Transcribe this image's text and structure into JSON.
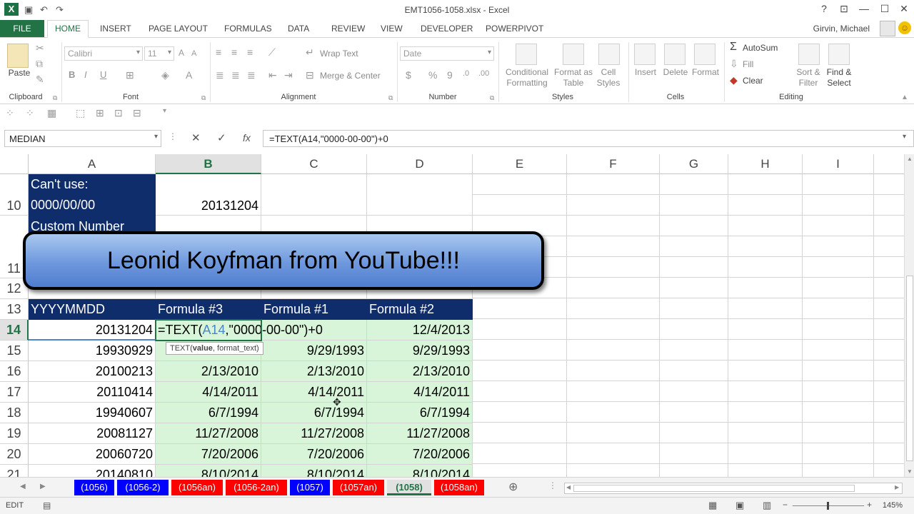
{
  "window": {
    "title": "EMT1056-1058.xlsx - Excel",
    "help": "?",
    "ribbon_display": "⊡",
    "minimize": "—",
    "maximize": "☐",
    "close": "✕"
  },
  "tabs": {
    "file": "FILE",
    "items": [
      "HOME",
      "INSERT",
      "PAGE LAYOUT",
      "FORMULAS",
      "DATA",
      "REVIEW",
      "VIEW",
      "DEVELOPER",
      "POWERPIVOT"
    ],
    "active": "HOME",
    "user": "Girvin, Michael"
  },
  "ribbon": {
    "clipboard": {
      "label": "Clipboard",
      "paste": "Paste"
    },
    "font": {
      "label": "Font",
      "name": "Calibri",
      "size": "11",
      "bold": "B",
      "italic": "I",
      "underline": "U"
    },
    "alignment": {
      "label": "Alignment",
      "wrap_text": "Wrap Text",
      "merge_center": "Merge & Center"
    },
    "number": {
      "label": "Number",
      "format": "Date",
      "currency": "$",
      "percent": "%",
      "comma": "9"
    },
    "styles": {
      "label": "Styles",
      "conditional": "Conditional",
      "formatting": "Formatting",
      "format_as": "Format as",
      "table": "Table",
      "cell": "Cell",
      "cell_styles": "Styles"
    },
    "cells": {
      "label": "Cells",
      "insert": "Insert",
      "delete": "Delete",
      "format": "Format"
    },
    "editing": {
      "label": "Editing",
      "autosum": "AutoSum",
      "fill": "Fill",
      "clear": "Clear",
      "sort": "Sort &",
      "filter": "Filter",
      "find": "Find &",
      "select": "Select"
    }
  },
  "formula_bar": {
    "name_box": "MEDIAN",
    "cancel": "✕",
    "enter": "✓",
    "fx": "fx",
    "formula": "=TEXT(A14,\"0000-00-00\")+0"
  },
  "grid": {
    "columns": [
      "A",
      "B",
      "C",
      "D",
      "E",
      "F",
      "G",
      "H",
      "I"
    ],
    "rows": {
      "r10": {
        "num": "10",
        "a1": "Can't use:",
        "a2": "0000/00/00",
        "b": "20131204"
      },
      "r11": {
        "num": "11",
        "a": "Custom Number"
      },
      "r12": {
        "num": "12"
      },
      "r13": {
        "num": "13",
        "a": "YYYYMMDD",
        "b": "Formula #3",
        "c": "Formula #1",
        "d": "Formula #2"
      },
      "r14": {
        "num": "14",
        "a": "20131204",
        "b_pre": "=TEXT(",
        "b_ref": "A14",
        "b_post": ",\"0000-00-00\")+0",
        "d": "12/4/2013"
      },
      "r15": {
        "num": "15",
        "a": "19930929",
        "b": "9/29/1993",
        "c": "9/29/1993",
        "d": "9/29/1993"
      },
      "r16": {
        "num": "16",
        "a": "20100213",
        "b": "2/13/2010",
        "c": "2/13/2010",
        "d": "2/13/2010"
      },
      "r17": {
        "num": "17",
        "a": "20110414",
        "b": "4/14/2011",
        "c": "4/14/2011",
        "d": "4/14/2011"
      },
      "r18": {
        "num": "18",
        "a": "19940607",
        "b": "6/7/1994",
        "c": "6/7/1994",
        "d": "6/7/1994"
      },
      "r19": {
        "num": "19",
        "a": "20081127",
        "b": "11/27/2008",
        "c": "11/27/2008",
        "d": "11/27/2008"
      },
      "r20": {
        "num": "20",
        "a": "20060720",
        "b": "7/20/2006",
        "c": "7/20/2006",
        "d": "7/20/2006"
      },
      "r21": {
        "num": "21",
        "a": "20140810",
        "b": "8/10/2014",
        "c": "8/10/2014",
        "d": "8/10/2014"
      }
    },
    "tooltip_pre": "TEXT(",
    "tooltip_bold": "value",
    "tooltip_post": ", format_text)"
  },
  "banner": "Leonid Koyfman from YouTube!!!",
  "sheet_tabs": [
    "(1056)",
    "(1056-2)",
    "(1056an)",
    "(1056-2an)",
    "(1057)",
    "(1057an)",
    "(1058)",
    "(1058an)"
  ],
  "sheet_add": "⊕",
  "status": {
    "mode": "EDIT",
    "zoom": "145%"
  }
}
